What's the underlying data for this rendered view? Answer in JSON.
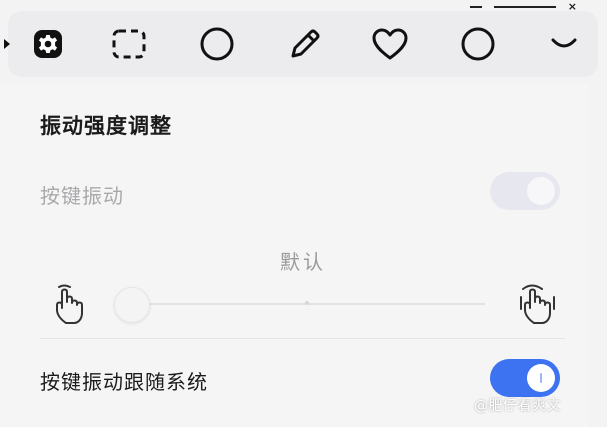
{
  "toolbar": {
    "icons": [
      "settings-icon",
      "screenshot-select-icon",
      "circle-icon",
      "pencil-icon",
      "heart-icon",
      "record-circle-icon",
      "chevron-down-icon"
    ]
  },
  "panel": {
    "section_title": "振动强度调整",
    "key_vibration_label": "按键振动",
    "key_vibration_enabled": true,
    "key_vibration_disabled_state": true,
    "vibration_level_label": "默认",
    "vibration_level_value": 0.0,
    "follow_system_label": "按键振动跟随系统",
    "follow_system_enabled": true
  },
  "watermark": "@肥仔看爽文",
  "colors": {
    "accent": "#3d72f0",
    "disabled_text": "#a9a9ac",
    "background": "#f5f5f6"
  }
}
